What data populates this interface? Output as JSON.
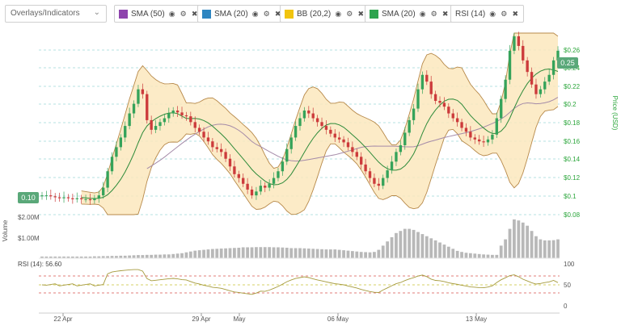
{
  "toolbar": {
    "select": {
      "value": "Overlays/Indicators"
    },
    "chips": [
      {
        "label": "SMA (50)",
        "color": "#8e44ad"
      },
      {
        "label": "SMA (20)",
        "color": "#2e86c1"
      },
      {
        "label": "BB (20,2)",
        "color": "#f1c40f"
      },
      {
        "label": "SMA (20)",
        "color": "#2ea44f"
      },
      {
        "label": "RSI (14)",
        "color": null
      }
    ]
  },
  "price_axis": {
    "label": "Price (USD)",
    "ticks": [
      "$0.26",
      "$0.24",
      "$0.22",
      "$0.2",
      "$0.18",
      "$0.16",
      "$0.14",
      "$0.12",
      "$0.1",
      "$0.08"
    ],
    "current_badge": "0.25",
    "start_badge": "0.10"
  },
  "volume_axis": {
    "label": "Volume",
    "ticks": [
      "$2.00M",
      "$1.00M"
    ]
  },
  "rsi": {
    "label": "RSI (14): 56.60",
    "ticks": [
      "100",
      "50",
      "0"
    ]
  },
  "x_axis": {
    "ticks": [
      "22 Apr",
      "29 Apr",
      "May",
      "06 May",
      "13 May"
    ]
  },
  "chart_data": {
    "type": "line",
    "price_range": [
      0.08,
      0.27
    ],
    "close": [
      0.1,
      0.1,
      0.099,
      0.098,
      0.097,
      0.098,
      0.097,
      0.096,
      0.097,
      0.096,
      0.096,
      0.095,
      0.097,
      0.1,
      0.108,
      0.125,
      0.14,
      0.15,
      0.16,
      0.172,
      0.185,
      0.195,
      0.21,
      0.205,
      0.178,
      0.168,
      0.172,
      0.176,
      0.18,
      0.185,
      0.188,
      0.186,
      0.183,
      0.182,
      0.176,
      0.17,
      0.166,
      0.16,
      0.156,
      0.15,
      0.148,
      0.145,
      0.138,
      0.13,
      0.122,
      0.118,
      0.112,
      0.106,
      0.1,
      0.104,
      0.11,
      0.108,
      0.112,
      0.118,
      0.125,
      0.135,
      0.148,
      0.16,
      0.172,
      0.18,
      0.188,
      0.185,
      0.18,
      0.176,
      0.172,
      0.168,
      0.164,
      0.16,
      0.158,
      0.155,
      0.15,
      0.145,
      0.14,
      0.132,
      0.125,
      0.118,
      0.112,
      0.11,
      0.118,
      0.126,
      0.135,
      0.145,
      0.152,
      0.165,
      0.178,
      0.19,
      0.21,
      0.225,
      0.218,
      0.205,
      0.198,
      0.196,
      0.192,
      0.185,
      0.18,
      0.176,
      0.17,
      0.166,
      0.16,
      0.158,
      0.156,
      0.155,
      0.158,
      0.163,
      0.18,
      0.2,
      0.22,
      0.25,
      0.265,
      0.255,
      0.24,
      0.228,
      0.215,
      0.205,
      0.21,
      0.218,
      0.225,
      0.24,
      0.25
    ],
    "volume_range": [
      0,
      2000000
    ],
    "volume": [
      80000,
      80000,
      80000,
      80000,
      80000,
      80000,
      80000,
      80000,
      80000,
      80000,
      80000,
      80000,
      90000,
      90000,
      100000,
      100000,
      110000,
      110000,
      120000,
      120000,
      130000,
      140000,
      150000,
      150000,
      160000,
      160000,
      170000,
      170000,
      180000,
      180000,
      200000,
      220000,
      240000,
      280000,
      320000,
      360000,
      380000,
      400000,
      420000,
      440000,
      450000,
      460000,
      470000,
      480000,
      490000,
      500000,
      520000,
      520000,
      520000,
      530000,
      530000,
      530000,
      530000,
      520000,
      520000,
      510000,
      500000,
      480000,
      480000,
      480000,
      470000,
      460000,
      450000,
      440000,
      430000,
      420000,
      420000,
      420000,
      400000,
      380000,
      360000,
      340000,
      320000,
      300000,
      290000,
      280000,
      300000,
      400000,
      600000,
      800000,
      1000000,
      1200000,
      1300000,
      1400000,
      1400000,
      1350000,
      1250000,
      1150000,
      1050000,
      950000,
      850000,
      750000,
      650000,
      550000,
      450000,
      350000,
      300000,
      260000,
      240000,
      220000,
      200000,
      180000,
      170000,
      160000,
      160000,
      600000,
      900000,
      1400000,
      1850000,
      1800000,
      1700000,
      1550000,
      1300000,
      1050000,
      900000,
      850000,
      850000,
      860000,
      900000
    ],
    "rsi_range": [
      0,
      100
    ],
    "rsi_levels": [
      70,
      50,
      30
    ],
    "rsi_last": 56.6
  }
}
